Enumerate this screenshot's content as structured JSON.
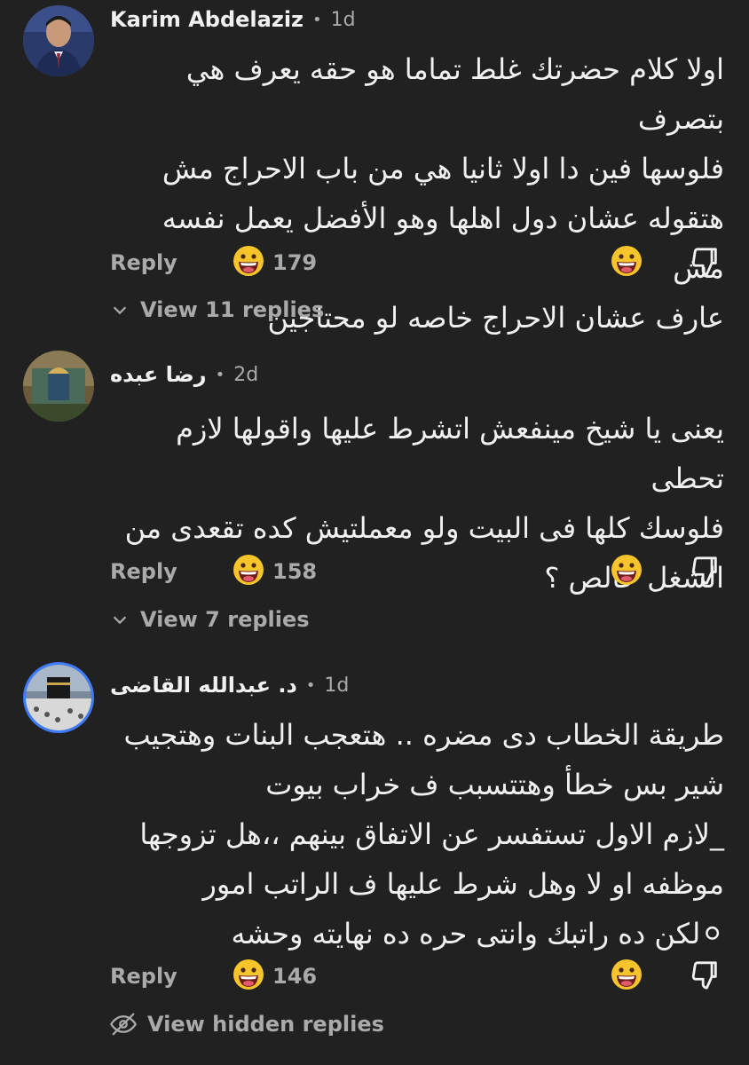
{
  "comments": [
    {
      "author": "Karim Abdelaziz",
      "time": "1d",
      "text": "اولا كلام حضرتك غلط تماما هو حقه يعرف هي بتصرف\nفلوسها فين دا اولا ثانيا هي من باب الاحراج مش\nهتقوله عشان دول اهلها وهو الأفضل يعمل نفسه مش\nعارف عشان الاحراج خاصه لو محتاجين",
      "reply_label": "Reply",
      "likes": "179",
      "view_replies": "View 11 replies"
    },
    {
      "author": "رضا عبده",
      "time": "2d",
      "text": "يعنى يا شيخ مينفعش اتشرط عليها واقولها لازم تحطى\nفلوسك كلها فى البيت ولو معملتيش كده تقعدى من\nالشغل خالص ؟",
      "reply_label": "Reply",
      "likes": "158",
      "view_replies": "View 7 replies"
    },
    {
      "author": "د. عبدالله القاضى",
      "time": "1d",
      "text": "طريقة الخطاب دى مضره .. هتعجب البنات وهتجيب\nشير بس خطأ وهتتسبب ف خراب بيوت\n_لازم الاول تستفسر عن الاتفاق بينهم ،،هل تزوجها\nموظفه او لا وهل شرط عليها ف الراتب امور\n⚪لكن ده راتبك وانتى حره ده نهايته وحشه",
      "reply_label": "Reply",
      "likes": "146",
      "view_replies": "View hidden replies"
    }
  ],
  "icons": {
    "like": "grinning-face-emoji",
    "react": "grinning-face-emoji",
    "dislike": "thumbs-down-icon",
    "expand": "chevron-down-icon",
    "hidden": "eye-off-icon"
  },
  "colors": {
    "background": "#212121",
    "text": "#f1f1f1",
    "secondary": "#aaaaaa",
    "avatar_ring": "#3d7bff"
  }
}
